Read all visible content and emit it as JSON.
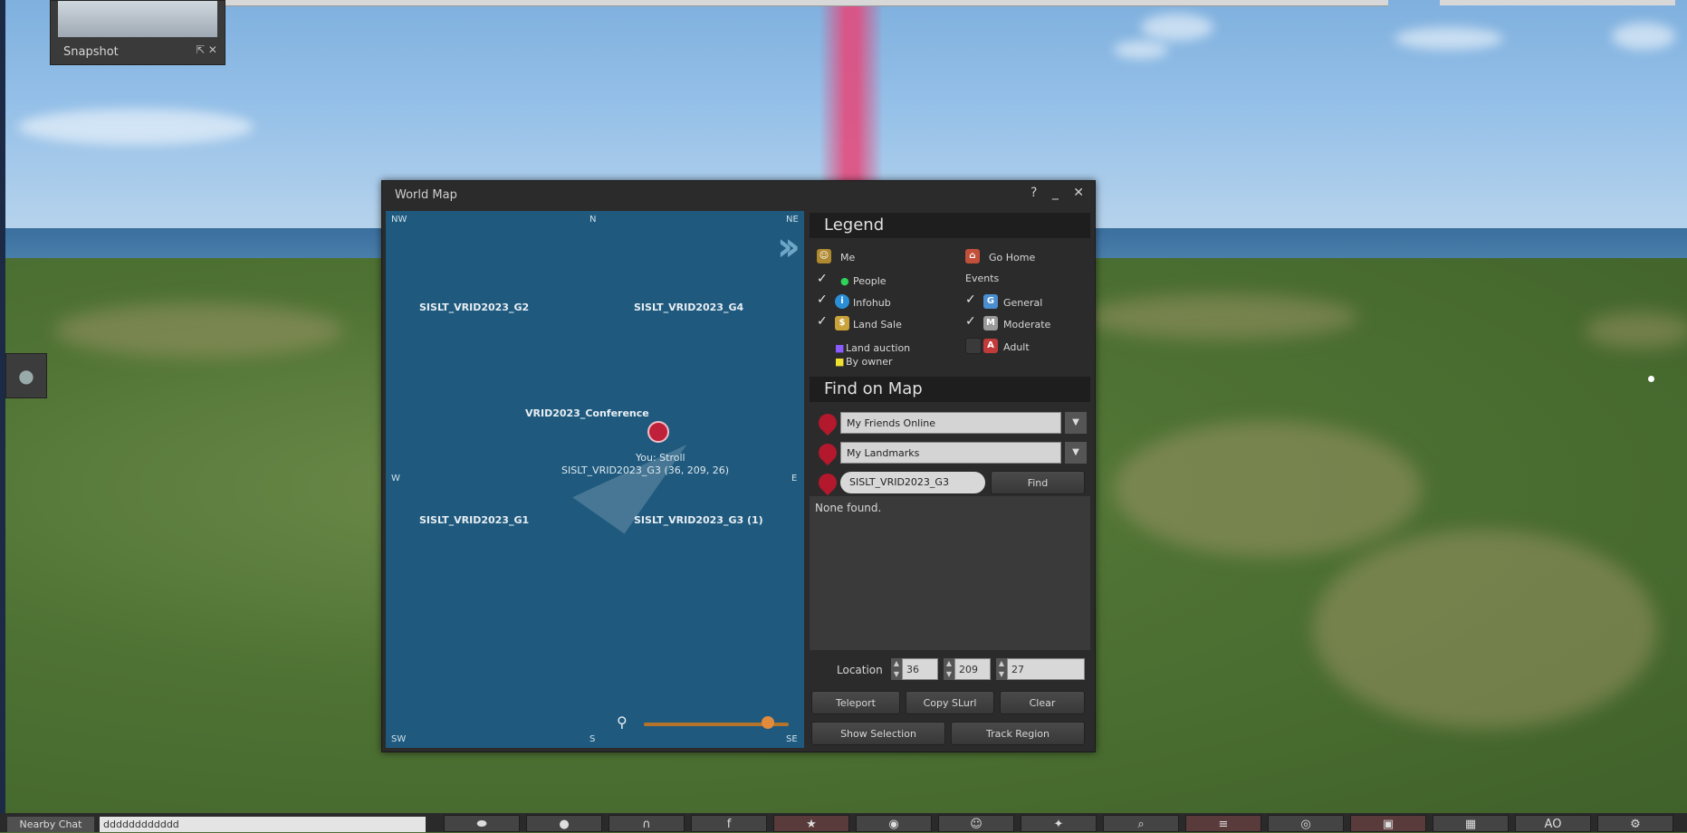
{
  "snapshot": {
    "label": "Snapshot",
    "controls": "⇱ ✕"
  },
  "world_map": {
    "title": "World Map",
    "controls": "? _ ✕",
    "map": {
      "compass": {
        "nw": "NW",
        "n": "N",
        "ne": "NE",
        "w": "W",
        "e": "E",
        "sw": "SW",
        "s": "S",
        "se": "SE"
      },
      "regions": [
        "SISLT_VRID2023_G2",
        "SISLT_VRID2023_G4",
        "VRID2023_Conference",
        "SISLT_VRID2023_G1",
        "SISLT_VRID2023_G3 (1)"
      ],
      "you": {
        "label": "You: Stroll",
        "location": "SISLT_VRID2023_G3 (36, 209, 26)"
      },
      "zoom_level": 0.82
    },
    "legend": {
      "title": "Legend",
      "me": "Me",
      "go_home": "Go Home",
      "people": "People",
      "infohub": "Infohub",
      "land_sale": "Land Sale",
      "auction": "Land auction",
      "by_owner": "By owner",
      "events_title": "Events",
      "general": "General",
      "moderate": "Moderate",
      "adult": "Adult"
    },
    "find": {
      "title": "Find on Map",
      "friends": "My Friends Online",
      "landmarks": "My Landmarks",
      "search_value": "SISLT_VRID2023_G3",
      "find_button": "Find",
      "results_text": "None found.",
      "location_label": "Location",
      "loc_x": "36",
      "loc_y": "209",
      "loc_z": "27",
      "teleport": "Teleport",
      "copy_slurl": "Copy SLurl",
      "clear": "Clear",
      "show_selection": "Show Selection",
      "track_region": "Track Region"
    }
  },
  "chat": {
    "nearby_label": "Nearby Chat",
    "input_value": "dddddddddddd"
  },
  "toolbar": [
    {
      "name": "chat-icon",
      "glyph": "⬬",
      "active": false
    },
    {
      "name": "speak-icon",
      "glyph": "●",
      "active": false
    },
    {
      "name": "voice-icon",
      "glyph": "∩",
      "active": false
    },
    {
      "name": "facebook-icon",
      "glyph": "f",
      "active": false
    },
    {
      "name": "walk-icon",
      "glyph": "★",
      "active": true
    },
    {
      "name": "view-icon",
      "glyph": "◉",
      "active": false
    },
    {
      "name": "people-icon",
      "glyph": "☺",
      "active": false
    },
    {
      "name": "appearance-icon",
      "glyph": "✦",
      "active": false
    },
    {
      "name": "search-icon",
      "glyph": "⌕",
      "active": false
    },
    {
      "name": "map-icon",
      "glyph": "≡",
      "active": true
    },
    {
      "name": "minimap-icon",
      "glyph": "◎",
      "active": false
    },
    {
      "name": "snapshot-icon",
      "glyph": "▣",
      "active": true
    },
    {
      "name": "inventory-icon",
      "glyph": "▦",
      "active": false
    },
    {
      "name": "ao-label",
      "glyph": "AO",
      "active": false
    },
    {
      "name": "settings-icon",
      "glyph": "⚙",
      "active": false
    }
  ]
}
